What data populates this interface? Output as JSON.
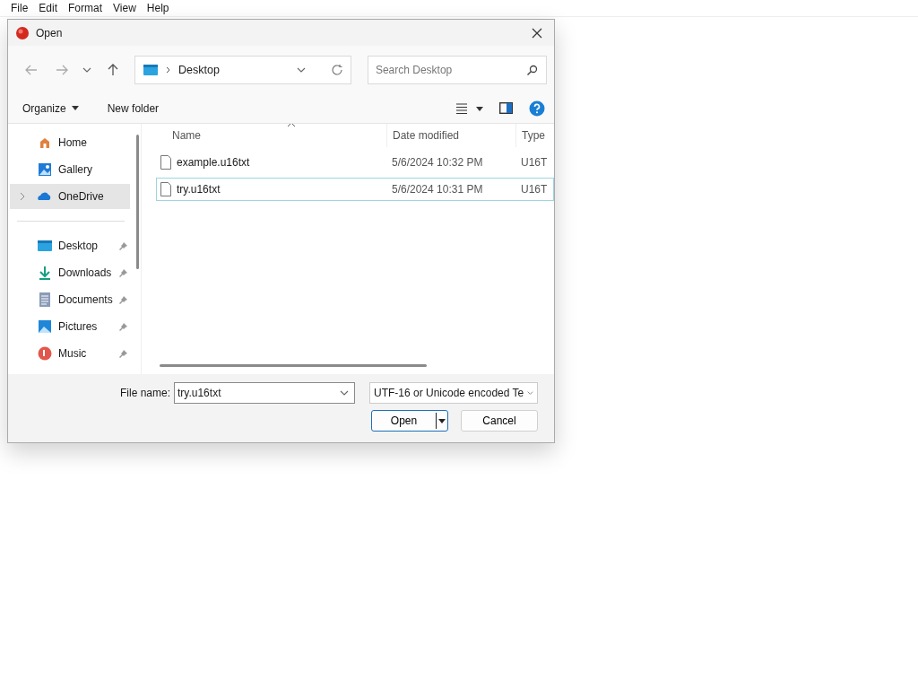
{
  "menu_bar": [
    "File",
    "Edit",
    "Format",
    "View",
    "Help"
  ],
  "dialog": {
    "title": "Open",
    "address": {
      "crumb": "Desktop"
    },
    "search": {
      "placeholder": "Search Desktop"
    },
    "toolbar": {
      "organize": "Organize",
      "new_folder": "New folder"
    },
    "sidebar": {
      "groups": [
        [
          {
            "label": "Home",
            "selected": false
          },
          {
            "label": "Gallery",
            "selected": false
          },
          {
            "label": "OneDrive",
            "selected": true,
            "expanded": false
          }
        ],
        [
          {
            "label": "Desktop",
            "selected": false,
            "pinned": true
          },
          {
            "label": "Downloads",
            "selected": false,
            "pinned": true
          },
          {
            "label": "Documents",
            "selected": false,
            "pinned": true
          },
          {
            "label": "Pictures",
            "selected": false,
            "pinned": true
          },
          {
            "label": "Music",
            "selected": false,
            "pinned": true
          }
        ]
      ]
    },
    "table": {
      "columns": [
        "Name",
        "Date modified",
        "Type"
      ],
      "rows": [
        {
          "name": "example.u16txt",
          "date": "5/6/2024 10:32 PM",
          "type": "U16T",
          "focused": false
        },
        {
          "name": "try.u16txt",
          "date": "5/6/2024 10:31 PM",
          "type": "U16T",
          "focused": true
        }
      ]
    },
    "file_name": {
      "label": "File name:",
      "value": "try.u16txt"
    },
    "file_type": {
      "value": "UTF-16 or Unicode encoded Te"
    },
    "buttons": {
      "open": "Open",
      "cancel": "Cancel"
    }
  }
}
